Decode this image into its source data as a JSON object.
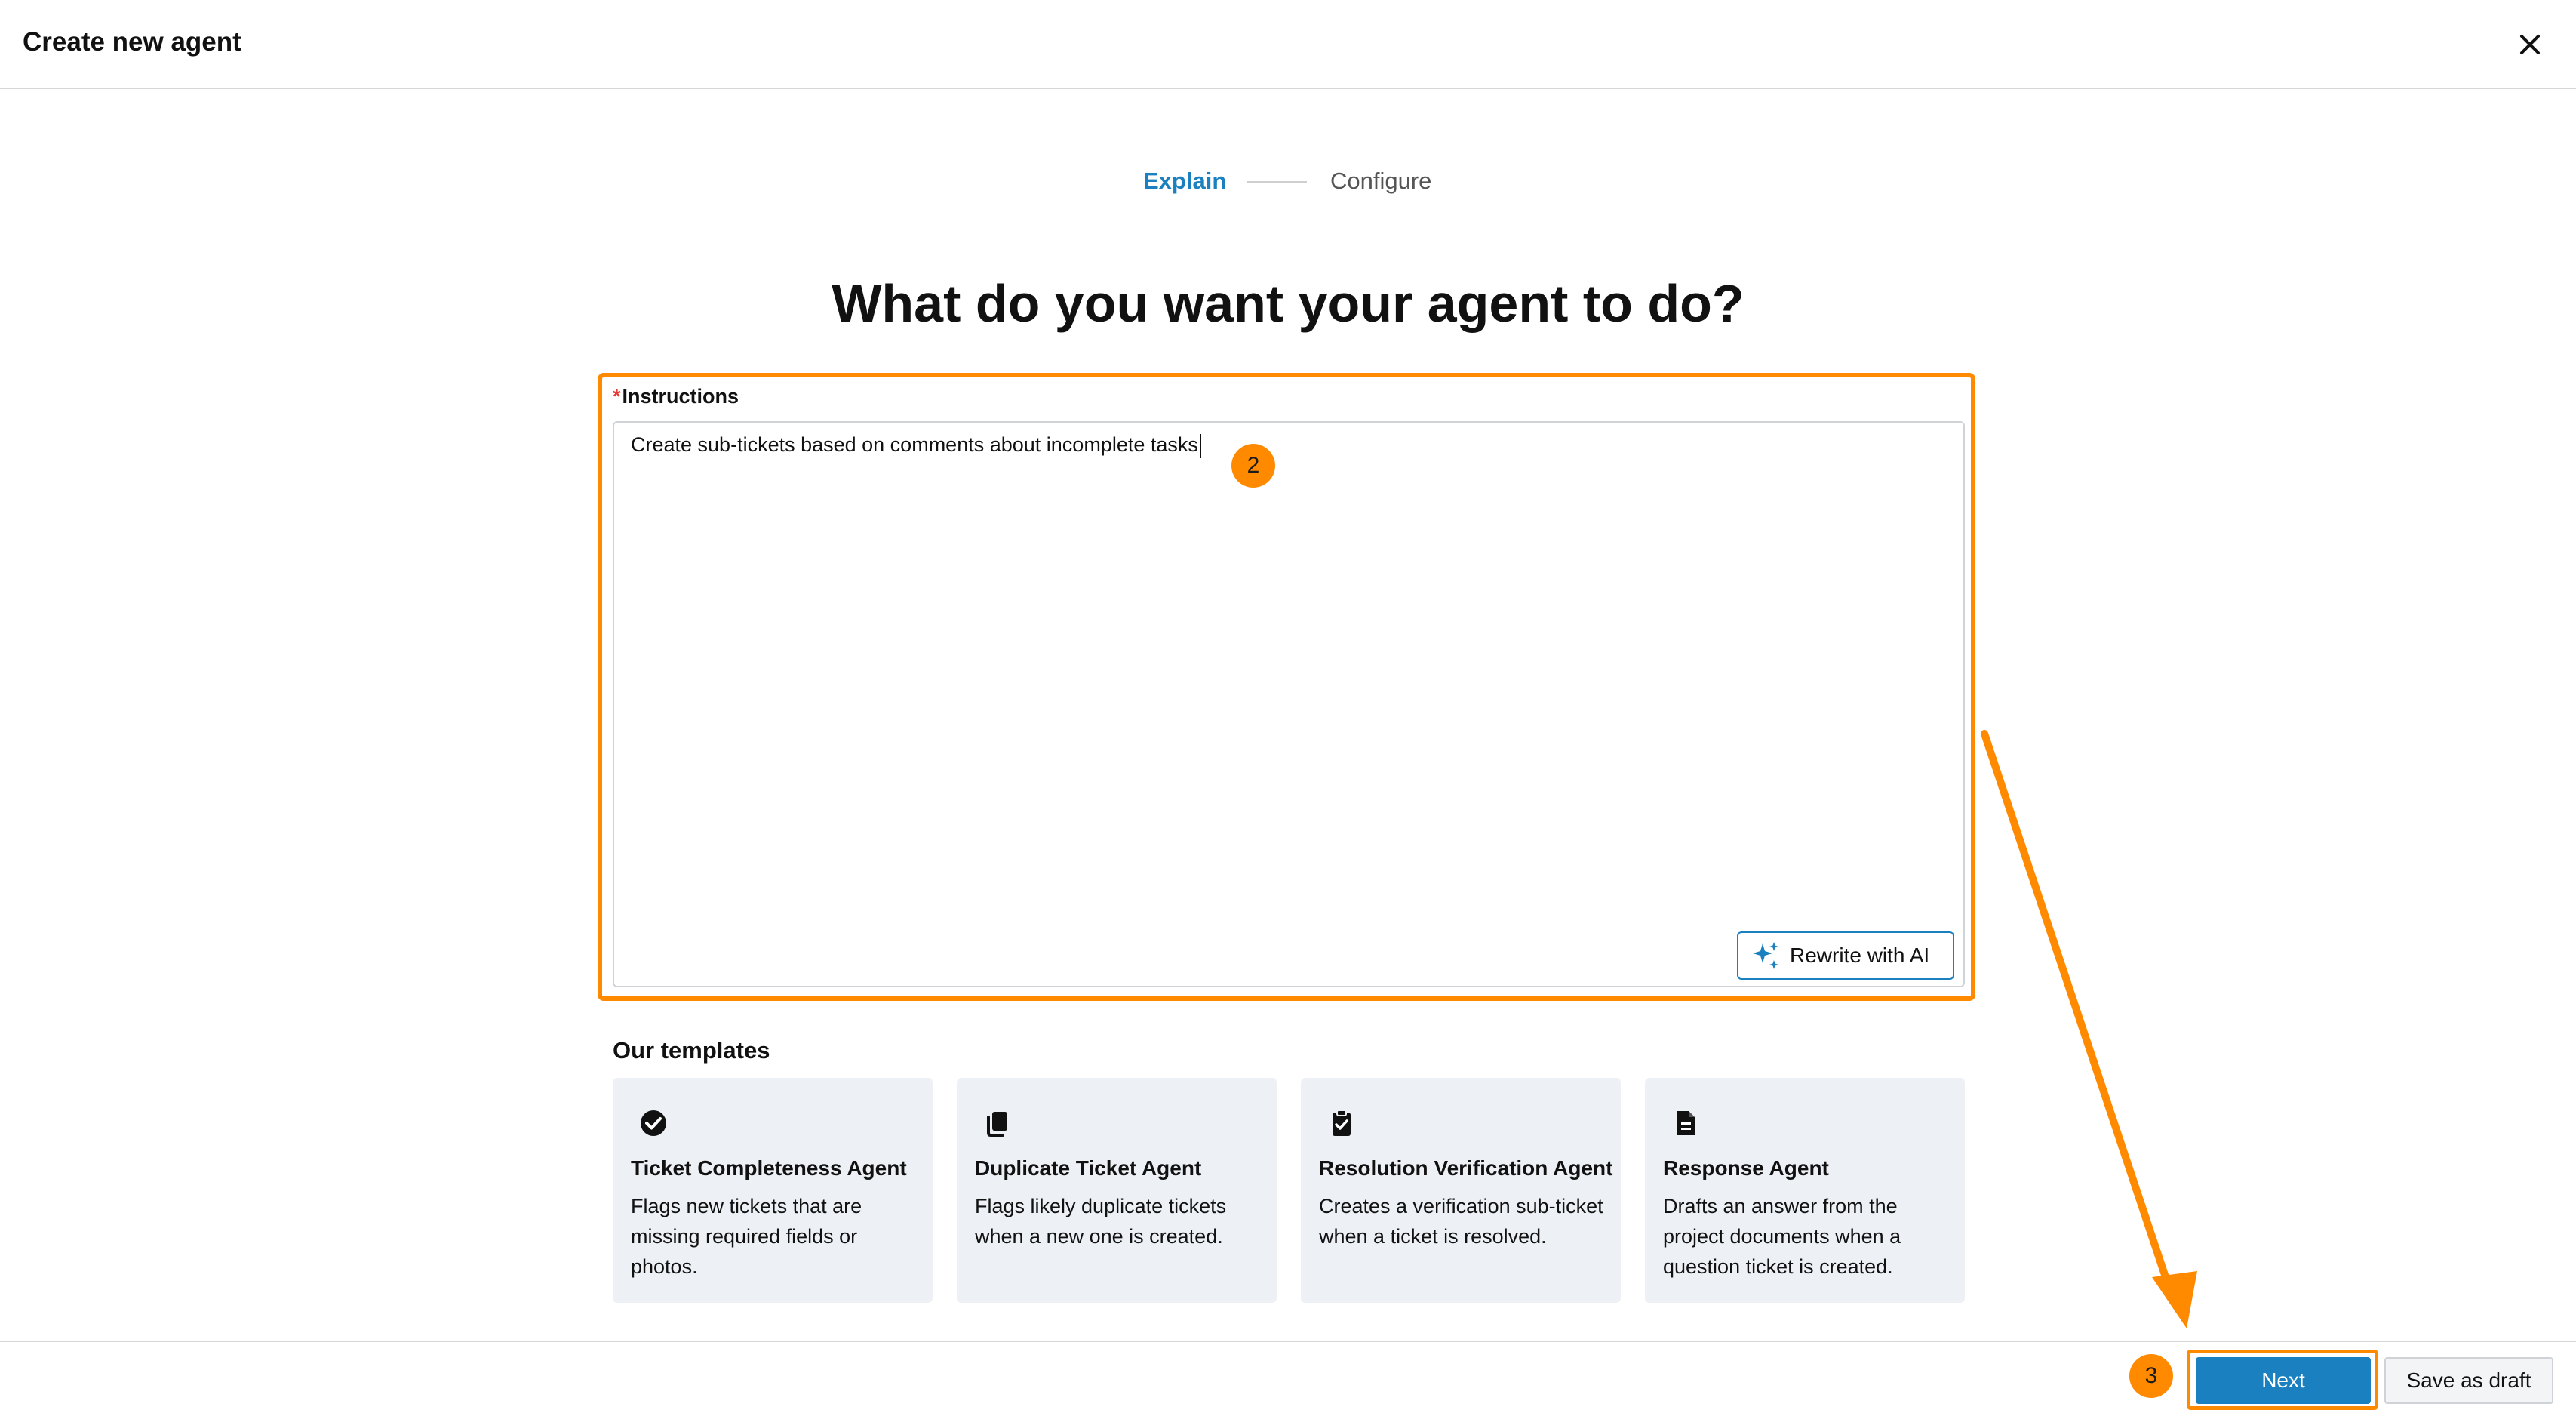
{
  "header": {
    "title": "Create new agent"
  },
  "stepper": {
    "step1": "Explain",
    "step2": "Configure"
  },
  "main": {
    "heading": "What do you want your agent to do?"
  },
  "instructions": {
    "required_mark": "*",
    "label": "Instructions",
    "value": "Create sub-tickets based on comments about incomplete tasks",
    "rewrite_label": "Rewrite with AI"
  },
  "annotations": {
    "badge_2": "2",
    "badge_3": "3"
  },
  "templates": {
    "title": "Our templates",
    "items": [
      {
        "name": "Ticket Completeness Agent",
        "description": "Flags new tickets that are missing required fields or photos.",
        "icon": "check-circle-icon"
      },
      {
        "name": "Duplicate Ticket Agent",
        "description": "Flags likely duplicate tickets when a new one is created.",
        "icon": "copy-icon"
      },
      {
        "name": "Resolution Verification Agent",
        "description": "Creates a verification sub-ticket when a ticket is resolved.",
        "icon": "clipboard-check-icon"
      },
      {
        "name": "Response Agent",
        "description": "Drafts an answer from the project documents when a question ticket is created.",
        "icon": "document-icon"
      }
    ]
  },
  "footer": {
    "next_label": "Next",
    "save_draft_label": "Save as draft"
  },
  "colors": {
    "accent": "#1a80bf",
    "highlight": "#ff8a00",
    "card_bg": "#edf1f5"
  }
}
